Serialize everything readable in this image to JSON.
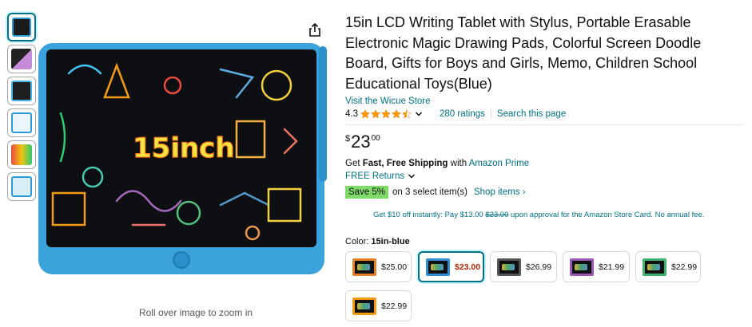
{
  "product": {
    "title": "15in LCD Writing Tablet with Stylus, Portable Erasable Electronic Magic Drawing Pads, Colorful Screen Doodle Board, Gifts for Boys and Girls, Memo, Children School Educational Toys(Blue)",
    "store_link": "Visit the Wicue Store",
    "rating_value": "4.3",
    "ratings_count": "280 ratings",
    "search_page": "Search this page",
    "image_caption": "15inch",
    "zoom_hint": "Roll over image to zoom in"
  },
  "price": {
    "symbol": "$",
    "whole": "23",
    "fraction": "00"
  },
  "shipping": {
    "prefix": "Get ",
    "bold": "Fast, Free Shipping",
    "with": " with ",
    "prime": "Amazon Prime",
    "returns": "FREE Returns"
  },
  "promo": {
    "badge": "Save 5%",
    "text": "on 3 select item(s)",
    "shop": "Shop items ›"
  },
  "card_offer": {
    "before": "Get $10 off instantly: Pay $13.00 ",
    "strike": "$23.00",
    "after": " upon approval for the Amazon Store Card. No annual fee."
  },
  "color": {
    "label": "Color: ",
    "value": "15in-blue"
  },
  "swatches": [
    {
      "price": "$25.00",
      "frame": "#e67e22"
    },
    {
      "price": "$23.00",
      "frame": "#2c8fd8"
    },
    {
      "price": "$26.99",
      "frame": "#555555"
    },
    {
      "price": "$21.99",
      "frame": "#9b59b6"
    },
    {
      "price": "$22.99",
      "frame": "#3cb371"
    },
    {
      "price": "$22.99",
      "frame": "#f39c12"
    }
  ],
  "colors": {
    "link": "#007185",
    "accent": "#ff9900",
    "deal": "#b12704",
    "badge": "#7fda69"
  }
}
